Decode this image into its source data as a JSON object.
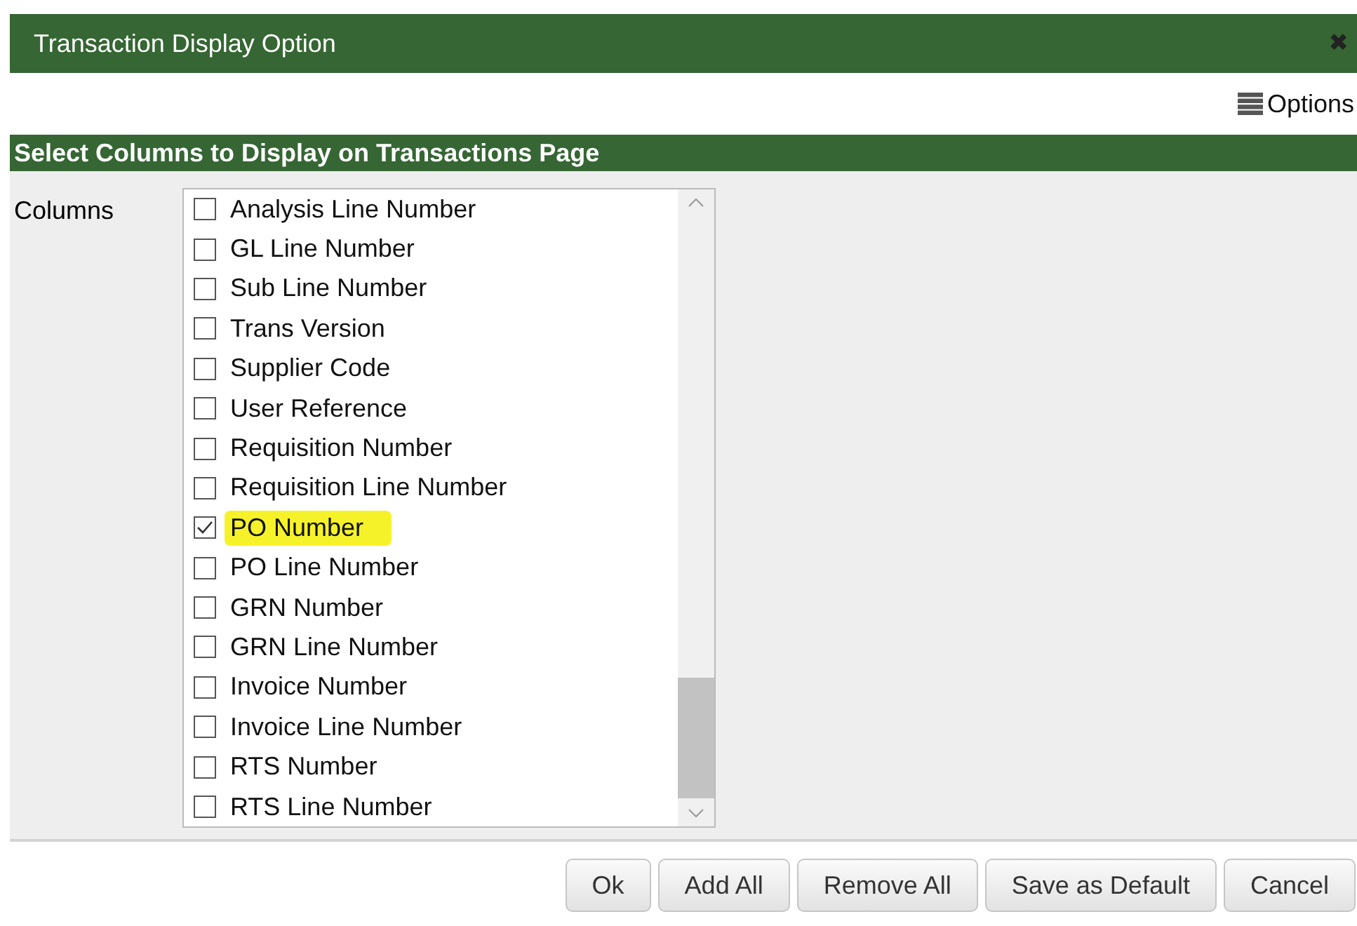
{
  "window": {
    "title": "Transaction Display Option",
    "close": "✖"
  },
  "options_menu": {
    "label": "Options"
  },
  "section": {
    "title": "Select Columns to Display on Transactions Page"
  },
  "columns_field": {
    "label": "Columns",
    "items": [
      {
        "label": "Analysis Line Number",
        "checked": false,
        "highlighted": false
      },
      {
        "label": "GL Line Number",
        "checked": false,
        "highlighted": false
      },
      {
        "label": "Sub Line Number",
        "checked": false,
        "highlighted": false
      },
      {
        "label": "Trans Version",
        "checked": false,
        "highlighted": false
      },
      {
        "label": "Supplier Code",
        "checked": false,
        "highlighted": false
      },
      {
        "label": "User Reference",
        "checked": false,
        "highlighted": false
      },
      {
        "label": "Requisition Number",
        "checked": false,
        "highlighted": false
      },
      {
        "label": "Requisition Line Number",
        "checked": false,
        "highlighted": false
      },
      {
        "label": "PO Number",
        "checked": true,
        "highlighted": true
      },
      {
        "label": "PO Line Number",
        "checked": false,
        "highlighted": false
      },
      {
        "label": "GRN Number",
        "checked": false,
        "highlighted": false
      },
      {
        "label": "GRN Line Number",
        "checked": false,
        "highlighted": false
      },
      {
        "label": "Invoice Number",
        "checked": false,
        "highlighted": false
      },
      {
        "label": "Invoice Line Number",
        "checked": false,
        "highlighted": false
      },
      {
        "label": "RTS Number",
        "checked": false,
        "highlighted": false
      },
      {
        "label": "RTS Line Number",
        "checked": false,
        "highlighted": false
      }
    ]
  },
  "buttons": [
    "Ok",
    "Add All",
    "Remove All",
    "Save as Default",
    "Cancel"
  ]
}
